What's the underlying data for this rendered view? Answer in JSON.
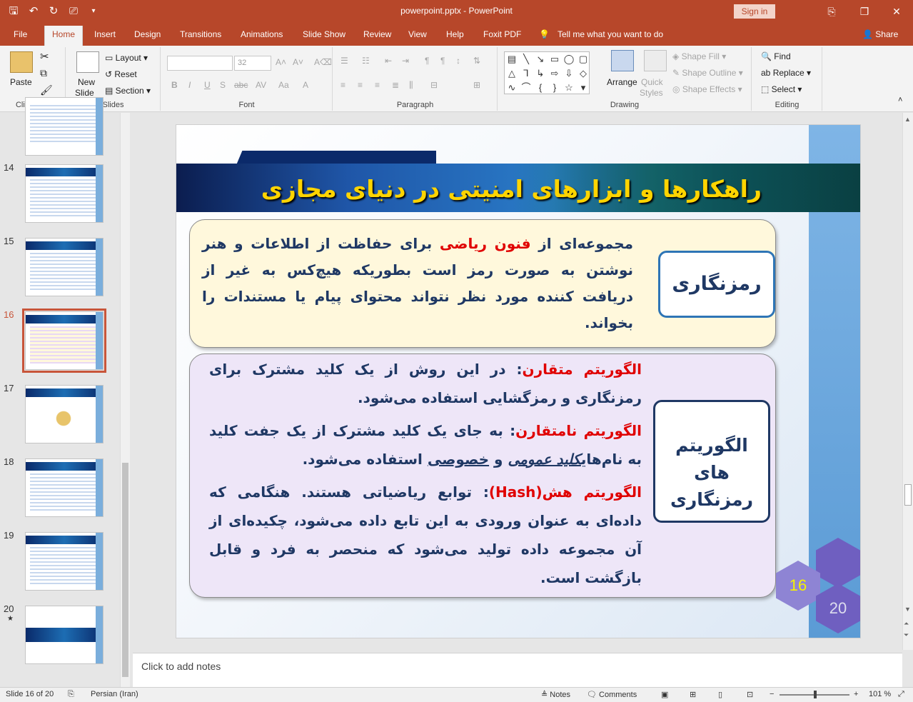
{
  "window": {
    "doc_title": "powerpoint.pptx  -  PowerPoint",
    "sign_in": "Sign in"
  },
  "tabs": [
    "File",
    "Home",
    "Insert",
    "Design",
    "Transitions",
    "Animations",
    "Slide Show",
    "Review",
    "View",
    "Help",
    "Foxit PDF"
  ],
  "tell_me": "Tell me what you want to do",
  "share": "Share",
  "ribbon": {
    "clipboard": {
      "paste": "Paste",
      "label": "Clipboard"
    },
    "slides": {
      "new_slide": "New",
      "new_slide2": "Slide",
      "layout": "Layout",
      "reset": "Reset",
      "section": "Section",
      "label": "Slides"
    },
    "font": {
      "size": "32",
      "label": "Font"
    },
    "paragraph": {
      "label": "Paragraph"
    },
    "drawing": {
      "arrange": "Arrange",
      "quick_styles": "Quick",
      "quick_styles2": "Styles",
      "shape_fill": "Shape Fill",
      "shape_outline": "Shape Outline",
      "shape_effects": "Shape Effects",
      "label": "Drawing"
    },
    "editing": {
      "find": "Find",
      "replace": "Replace",
      "select": "Select",
      "label": "Editing"
    }
  },
  "thumbnails": [
    {
      "num": "14"
    },
    {
      "num": "15"
    },
    {
      "num": "16"
    },
    {
      "num": "17"
    },
    {
      "num": "18"
    },
    {
      "num": "19"
    },
    {
      "num": "20"
    }
  ],
  "slide": {
    "title": "راهکارها و ابزارهای امنیتی در دنیای مجازی",
    "box1_label": "رمزنگاری",
    "box1_text_a": "مجموعه‌ای از ",
    "box1_text_red": "فنون ریاضی",
    "box1_text_b": " برای حفاظت از اطلاعات و هنر نوشتن به صورت رمز است بطوریکه هیچ‌کس به غیر از دریافت کننده مورد نظر نتواند محتوای پیام یا مستندات را بخواند.",
    "box2_label_1": "الگوریتم  های",
    "box2_label_2": "رمزنگاری",
    "p1_head": "الگوریتم متقارن",
    "p1_body": ":  در این روش از یک کلید مشترک برای رمزنگاری و رمزگشایی استفاده می‌شود.",
    "p2_head": "الگوریتم نامتقارن",
    "p2_body_a": ": به جای یک کلید مشترک از یک جفت کلید به نام‌های",
    "p2_key1": "کلید عمومی",
    "p2_and": " و ",
    "p2_key2": "خصوصی",
    "p2_body_b": " استفاده می‌شود.",
    "p3_head": "الگوریتم هش(Hash)",
    "p3_body": ": توابع ریاضیاتی هستند. هنگامی که داده‌ای به عنوان ورودی به این تابع داده می‌شود، چکیده‌ای از آن مجموعه داده تولید می‌شود که منحصر به فرد و قابل بازگشت است.",
    "hex_current": "16",
    "hex_total": "20"
  },
  "notes_placeholder": "Click to add notes",
  "status": {
    "slide_of": "Slide 16 of 20",
    "language": "Persian (Iran)",
    "notes": "Notes",
    "comments": "Comments",
    "zoom": "101 %"
  }
}
